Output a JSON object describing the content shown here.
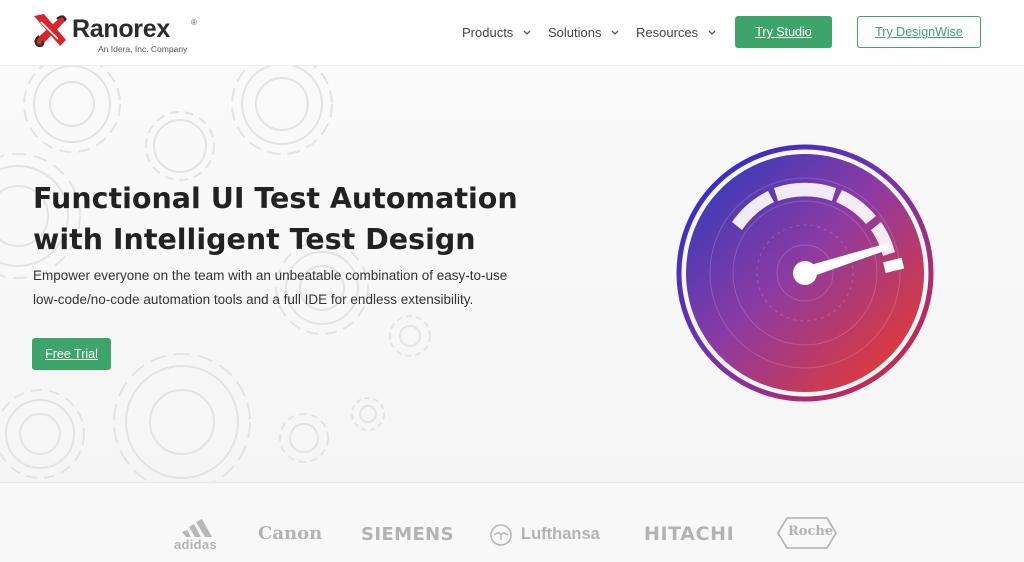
{
  "brand": {
    "name": "Ranorex",
    "registered": "®",
    "tagline": "An Idera, Inc. Company",
    "accent_color": "#3da46a",
    "logo_red": "#d8262c"
  },
  "nav": {
    "items": [
      {
        "label": "Products",
        "icon": "chevron-down-icon"
      },
      {
        "label": "Solutions",
        "icon": "chevron-down-icon"
      },
      {
        "label": "Resources",
        "icon": "chevron-down-icon"
      }
    ],
    "try_studio": "Try Studio",
    "try_designwise": "Try DesignWise"
  },
  "hero": {
    "title_line1": "Functional UI Test Automation",
    "title_line2": "with Intelligent Test Design",
    "description": "Empower everyone on the team with an unbeatable combination of easy-to-use low-code/no-code automation tools and a full IDE for endless extensibility.",
    "cta": "Free Trial",
    "illustration": "speedometer-gauge"
  },
  "clients": [
    "adidas",
    "Canon",
    "SIEMENS",
    "Lufthansa",
    "HITACHI",
    "Roche"
  ]
}
